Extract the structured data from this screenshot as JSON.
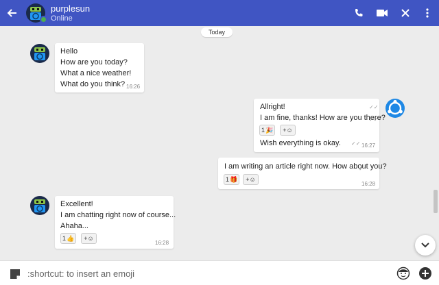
{
  "header": {
    "contact_name": "purplesun",
    "contact_status": "Online",
    "icons": {
      "back": "arrow-left-icon",
      "call": "phone-icon",
      "video": "video-camera-icon",
      "close": "close-icon",
      "more": "more-vertical-icon"
    },
    "color": "#4055c3"
  },
  "day_separator": "Today",
  "messages": [
    {
      "direction": "incoming",
      "lines": [
        "Hello",
        "How are you today?",
        "What a nice weather!",
        "What do you think?"
      ],
      "time": "16:26"
    },
    {
      "direction": "outgoing",
      "lines": [
        "Allright!",
        "I am fine, thanks! How are you there?"
      ],
      "reaction": {
        "count": "1",
        "emoji": "🎉"
      },
      "add_reaction": "+☺",
      "lines2": [
        "Wish everything is okay."
      ],
      "time": "16:27"
    },
    {
      "direction": "outgoing",
      "lines": [
        "I am writing an article right now. How about you?"
      ],
      "reaction": {
        "count": "1",
        "emoji": "🎁"
      },
      "add_reaction": "+☺",
      "time": "16:28"
    },
    {
      "direction": "incoming",
      "lines": [
        "Excellent!",
        "I am chatting right now of course...",
        "Ahaha..."
      ],
      "reaction": {
        "count": "1",
        "emoji": "👍"
      },
      "add_reaction": "+☺",
      "time": "16:28"
    }
  ],
  "composer": {
    "placeholder": ":shortcut: to insert an emoji",
    "icons": {
      "sticker": "sticker-icon",
      "emoji": "emoji-face-icon",
      "add": "plus-circle-icon"
    }
  }
}
